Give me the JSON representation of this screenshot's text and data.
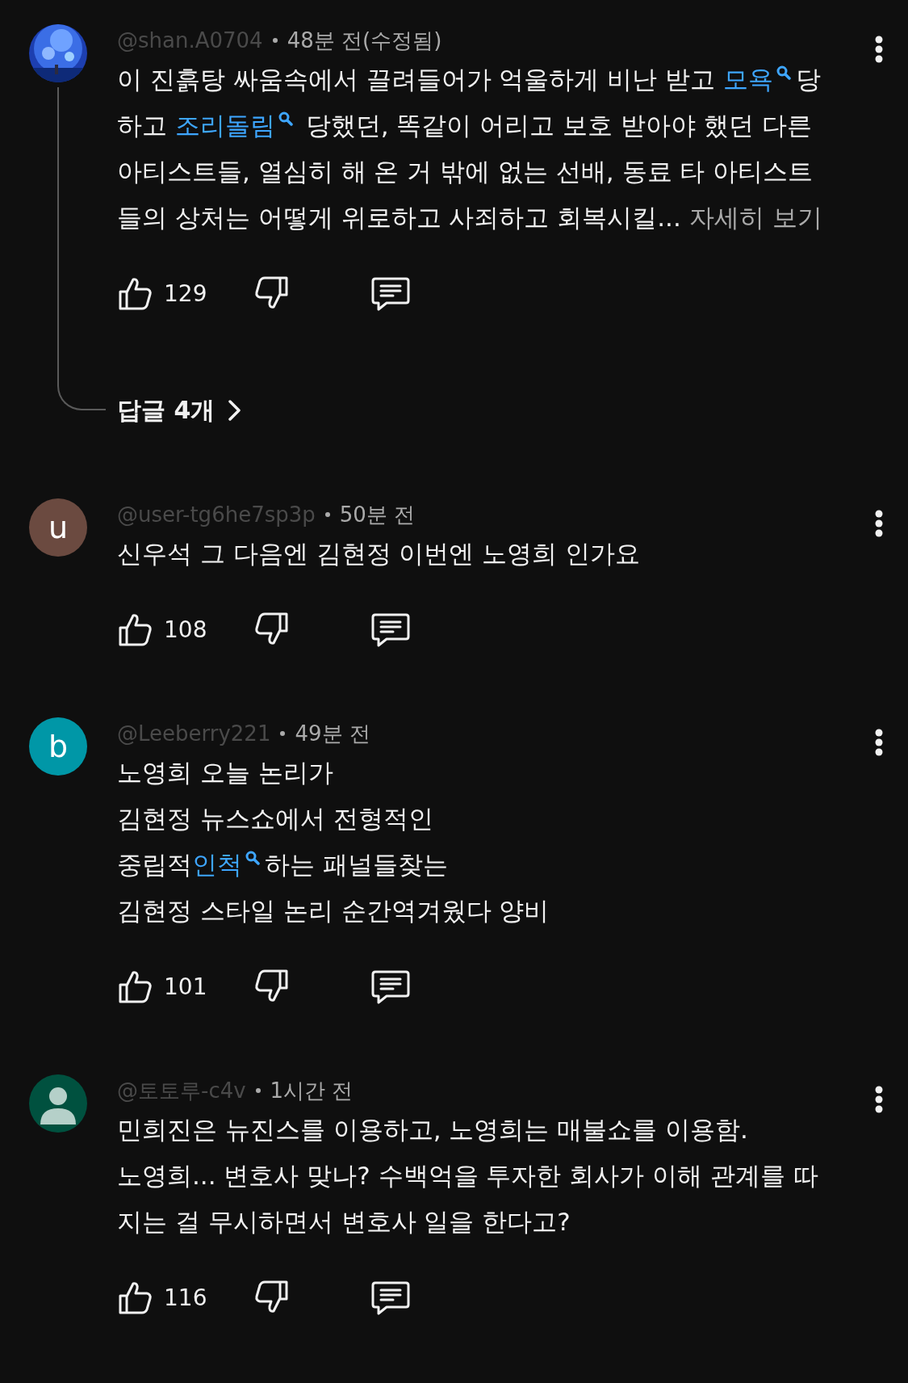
{
  "comments": [
    {
      "avatar": {
        "kind": "picture"
      },
      "author": "@shan.A0704",
      "time": "48분 전(수정됨)",
      "body": [
        [
          {
            "kind": "text",
            "text": "이 진흙탕 싸움속에서 끌려들어가 억울하게 비난 받고 "
          },
          {
            "kind": "link",
            "text": "모욕"
          },
          {
            "kind": "text",
            "text": "당"
          }
        ],
        [
          {
            "kind": "text",
            "text": "하고 "
          },
          {
            "kind": "link",
            "text": "조리돌림"
          },
          {
            "kind": "text",
            "text": " 당했던, 똑같이 어리고 보호 받아야 했던 다른"
          }
        ],
        [
          {
            "kind": "text",
            "text": "아티스트들, 열심히 해  온 거 밖에 없는 선배, 동료 타 아티스트"
          }
        ],
        [
          {
            "kind": "text",
            "text": "들의 상처는 어떻게 위로하고 사죄하고 회복시킬... "
          },
          {
            "kind": "more",
            "text": "자세히 보기"
          }
        ]
      ],
      "likes": "129",
      "replies": "답글 4개"
    },
    {
      "avatar": {
        "kind": "letter",
        "letter": "u",
        "color": "#6b4a40"
      },
      "author": "@user-tg6he7sp3p",
      "time": "50분 전",
      "body": [
        [
          {
            "kind": "text",
            "text": "신우석 그 다음엔 김현정 이번엔 노영희 인가요"
          }
        ]
      ],
      "likes": "108"
    },
    {
      "avatar": {
        "kind": "letter",
        "letter": "b",
        "color": "#0097a7"
      },
      "author": "@Leeberry221",
      "time": "49분 전",
      "body": [
        [
          {
            "kind": "text",
            "text": "노영희 오늘 논리가"
          }
        ],
        [
          {
            "kind": "text",
            "text": "김현정 뉴스쇼에서 전형적인"
          }
        ],
        [
          {
            "kind": "text",
            "text": "중립적"
          },
          {
            "kind": "link",
            "text": "인척"
          },
          {
            "kind": "text",
            "text": "하는 패널들찾는"
          }
        ],
        [
          {
            "kind": "text",
            "text": "김현정 스타일 논리 순간역겨웠다 양비"
          }
        ]
      ],
      "likes": "101"
    },
    {
      "avatar": {
        "kind": "silhouette",
        "color": "#00513f"
      },
      "author": "@토토루-c4v",
      "time": "1시간 전",
      "body": [
        [
          {
            "kind": "text",
            "text": "민희진은 뉴진스를 이용하고, 노영희는 매불쇼를 이용함."
          }
        ],
        [
          {
            "kind": "text",
            "text": "노영희... 변호사 맞나? 수백억을 투자한 회사가 이해 관계를 따"
          }
        ],
        [
          {
            "kind": "text",
            "text": "지는 걸 무시하면서 변호사 일을 한다고?"
          }
        ]
      ],
      "likes": "116"
    }
  ]
}
